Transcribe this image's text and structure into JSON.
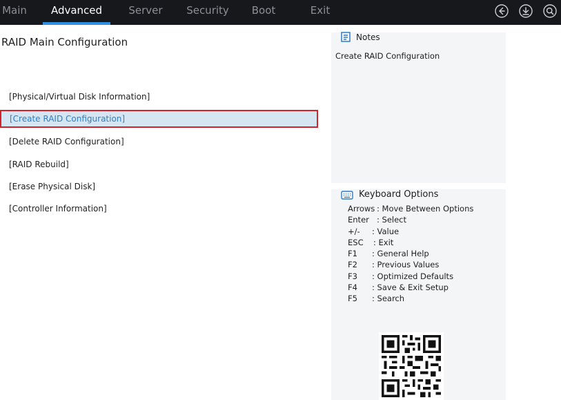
{
  "topbar": {
    "tabs": [
      {
        "label": "Main",
        "active": false
      },
      {
        "label": "Advanced",
        "active": true
      },
      {
        "label": "Server",
        "active": false
      },
      {
        "label": "Security",
        "active": false
      },
      {
        "label": "Boot",
        "active": false
      },
      {
        "label": "Exit",
        "active": false
      }
    ],
    "icons": [
      "back-icon",
      "download-icon",
      "search-icon"
    ],
    "accent_color": "#2f8fe0"
  },
  "main": {
    "title": "RAID Main Configuration",
    "items": [
      {
        "label": "[Physical/Virtual Disk Information]",
        "selected": false
      },
      {
        "label": "[Create RAID Configuration]",
        "selected": true
      },
      {
        "label": "[Delete RAID Configuration]",
        "selected": false
      },
      {
        "label": "[RAID Rebuild]",
        "selected": false
      },
      {
        "label": "[Erase Physical Disk]",
        "selected": false
      },
      {
        "label": "[Controller Information]",
        "selected": false
      }
    ],
    "highlight_border_color": "#d3232a",
    "selected_text_color": "#2f7ec7"
  },
  "notes": {
    "title": "Notes",
    "text": "Create RAID Configuration"
  },
  "keyboard": {
    "title": "Keyboard Options",
    "options": [
      {
        "key": "Arrows",
        "desc": ": Move Between Options"
      },
      {
        "key": "Enter",
        "desc": ": Select"
      },
      {
        "key": "+/-",
        "desc": ": Value"
      },
      {
        "key": "ESC",
        "desc": ": Exit"
      },
      {
        "key": "F1",
        "desc": ": General Help"
      },
      {
        "key": "F2",
        "desc": ": Previous Values"
      },
      {
        "key": "F3",
        "desc": ": Optimized Defaults"
      },
      {
        "key": "F4",
        "desc": ": Save & Exit Setup"
      },
      {
        "key": "F5",
        "desc": ": Search"
      }
    ]
  }
}
